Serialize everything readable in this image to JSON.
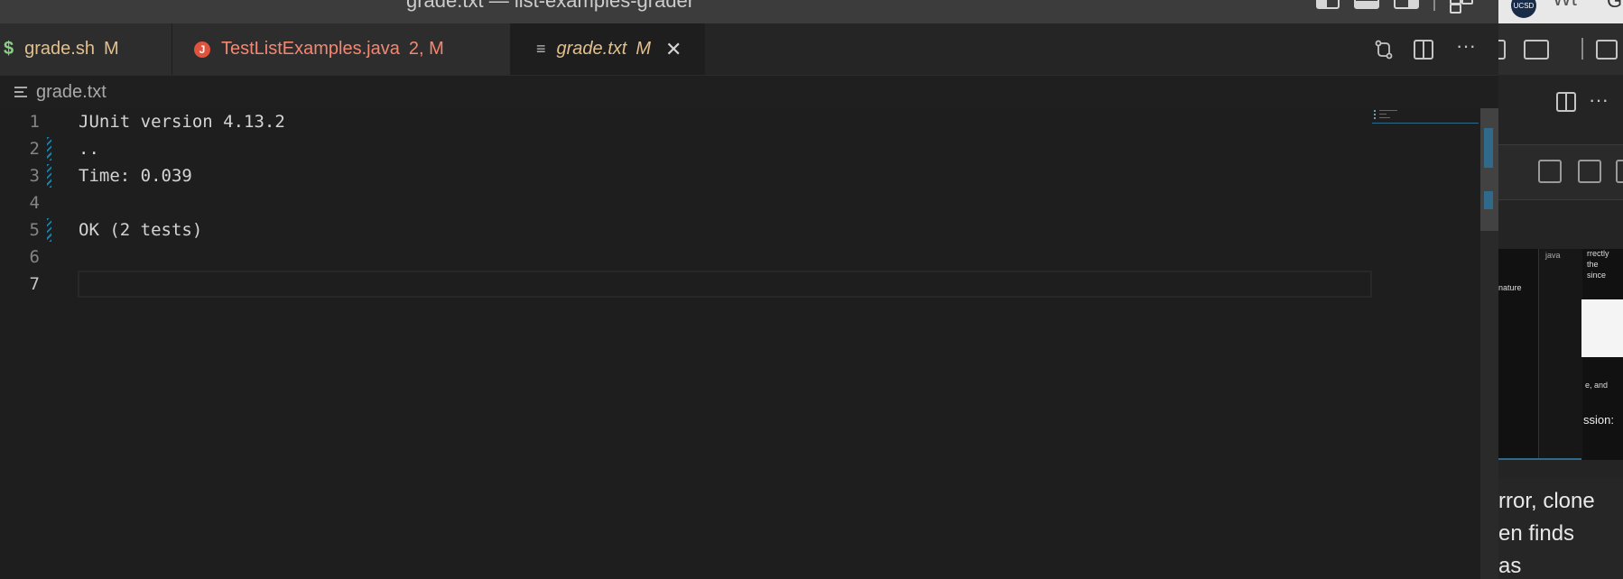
{
  "window": {
    "title": "grade.txt — list-examples-grader"
  },
  "tabs": [
    {
      "icon": "$",
      "name": "grade.sh",
      "badge": "M"
    },
    {
      "icon": "J",
      "name": "TestListExamples.java",
      "badge": "2, M"
    },
    {
      "icon": "≡",
      "name": "grade.txt",
      "badge": "M",
      "close": "✕"
    }
  ],
  "editor_actions": {
    "more": "···"
  },
  "breadcrumb": {
    "file": "grade.txt"
  },
  "editor": {
    "lines": [
      {
        "num": "1",
        "text": "JUnit version 4.13.2"
      },
      {
        "num": "2",
        "text": ".."
      },
      {
        "num": "3",
        "text": "Time: 0.039"
      },
      {
        "num": "4",
        "text": ""
      },
      {
        "num": "5",
        "text": "OK (2 tests)"
      },
      {
        "num": "6",
        "text": ""
      },
      {
        "num": "7",
        "text": ""
      }
    ]
  },
  "side_window": {
    "logo": "UCSD",
    "tab_fragment": "Wt",
    "g_fragment": "G",
    "more": "···",
    "java_label": "java",
    "frag_rrectly": "rrectly",
    "frag_the": "the",
    "frag_since": "since",
    "frag_nature": "nature",
    "frag_and": "e, and",
    "frag_ssion": "ssion:",
    "text_1": "rror, clone",
    "text_2": "en finds",
    "text_3": "as"
  },
  "colors": {
    "modified": "#e2c08d",
    "error": "#f48771",
    "shell_icon": "#89d185",
    "gutter_change": "#1b81a8"
  }
}
